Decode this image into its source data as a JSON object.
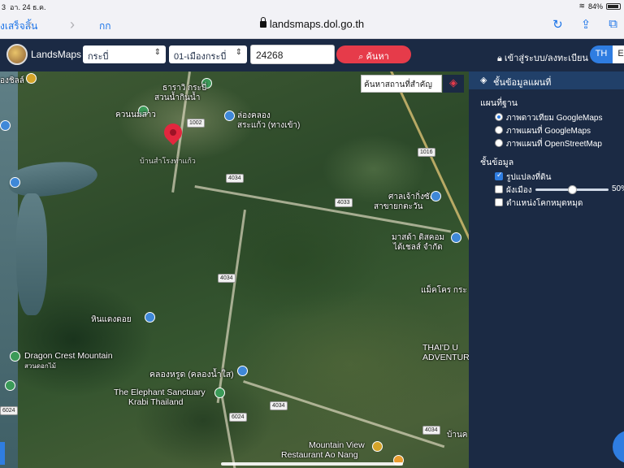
{
  "status_bar": {
    "time": "3",
    "date": "อา. 24 ธ.ค.",
    "battery": "84%"
  },
  "safari": {
    "done_label": "งเสร็จสิ้น",
    "back_icon": "chevron-left-icon",
    "forward_icon": "chevron-right-icon",
    "text_size_label": "กก",
    "url": "landsmaps.dol.go.th",
    "reload_icon": "reload-icon",
    "share_icon": "share-icon"
  },
  "header": {
    "brand": "LandsMaps",
    "province": "กระบี่",
    "district": "01-เมืองกระบี่",
    "parcel_number": "24268",
    "search_label": "ค้นหา",
    "login_label": "เข้าสู่ระบบ/ลงทะเบียน",
    "lang_active": "TH",
    "lang_other": "E"
  },
  "map": {
    "place_search_placeholder": "ค้นหาสถานที่สำคัญ",
    "labels": {
      "l1": "องชิลล์",
      "l2": "ธาราวิ กระบี่",
      "l3": "สวนน้ำกินน้ำ",
      "l4": "ควนนมสาว",
      "l5": "ล่องคลอง",
      "l6": "สระแก้ว (ทางเข้า)",
      "l7": "บ้านสำโรงท่าแก้ว",
      "l8": "ศาลเจ้ากิ่งซัง",
      "l9": "สาขายกตะวัน",
      "l10": "มาสด้า ดิสคอม",
      "l11": "ได้เชลส์ จำกัด",
      "l12": "แม็คโคร กระ",
      "l13": "หินแดงดอย",
      "l14": "Dragon Crest Mountain",
      "l15": "สวนดอกไม้",
      "l16": "THAI'D U",
      "l17": "ADVENTURE",
      "l18": "คลองหรูด (คลองน้ำใส)",
      "l19": "The Elephant Sanctuary",
      "l20": "Krabi Thailand",
      "l21": "Mountain View",
      "l22": "Restaurant Ao Nang",
      "l23": "บ้านค"
    },
    "road_shields": {
      "r1": "1002",
      "r2": "4034",
      "r3": "1016",
      "r4": "4033",
      "r5": "4034",
      "r6": "4034",
      "r7": "6024",
      "r8": "6024",
      "r9": "4034"
    }
  },
  "panel": {
    "title": "ชั้นข้อมูลแผนที่",
    "base_map_label": "แผนที่ฐาน",
    "base_options": [
      "ภาพดาวเทียม GoogleMaps",
      "ภาพแผนที่ GoogleMaps",
      "ภาพแผนที่ OpenStreetMap"
    ],
    "base_selected": 0,
    "data_layers_label": "ชั้นข้อมูล",
    "layer_parcel": "รูปแปลงที่ดิน",
    "layer_cityplan": "ผังเมือง",
    "layer_cityplan_opacity": "50%",
    "opacity_value": 0.5,
    "layer_benchmark": "ตำแหน่งโคกหมุดหมุด"
  }
}
